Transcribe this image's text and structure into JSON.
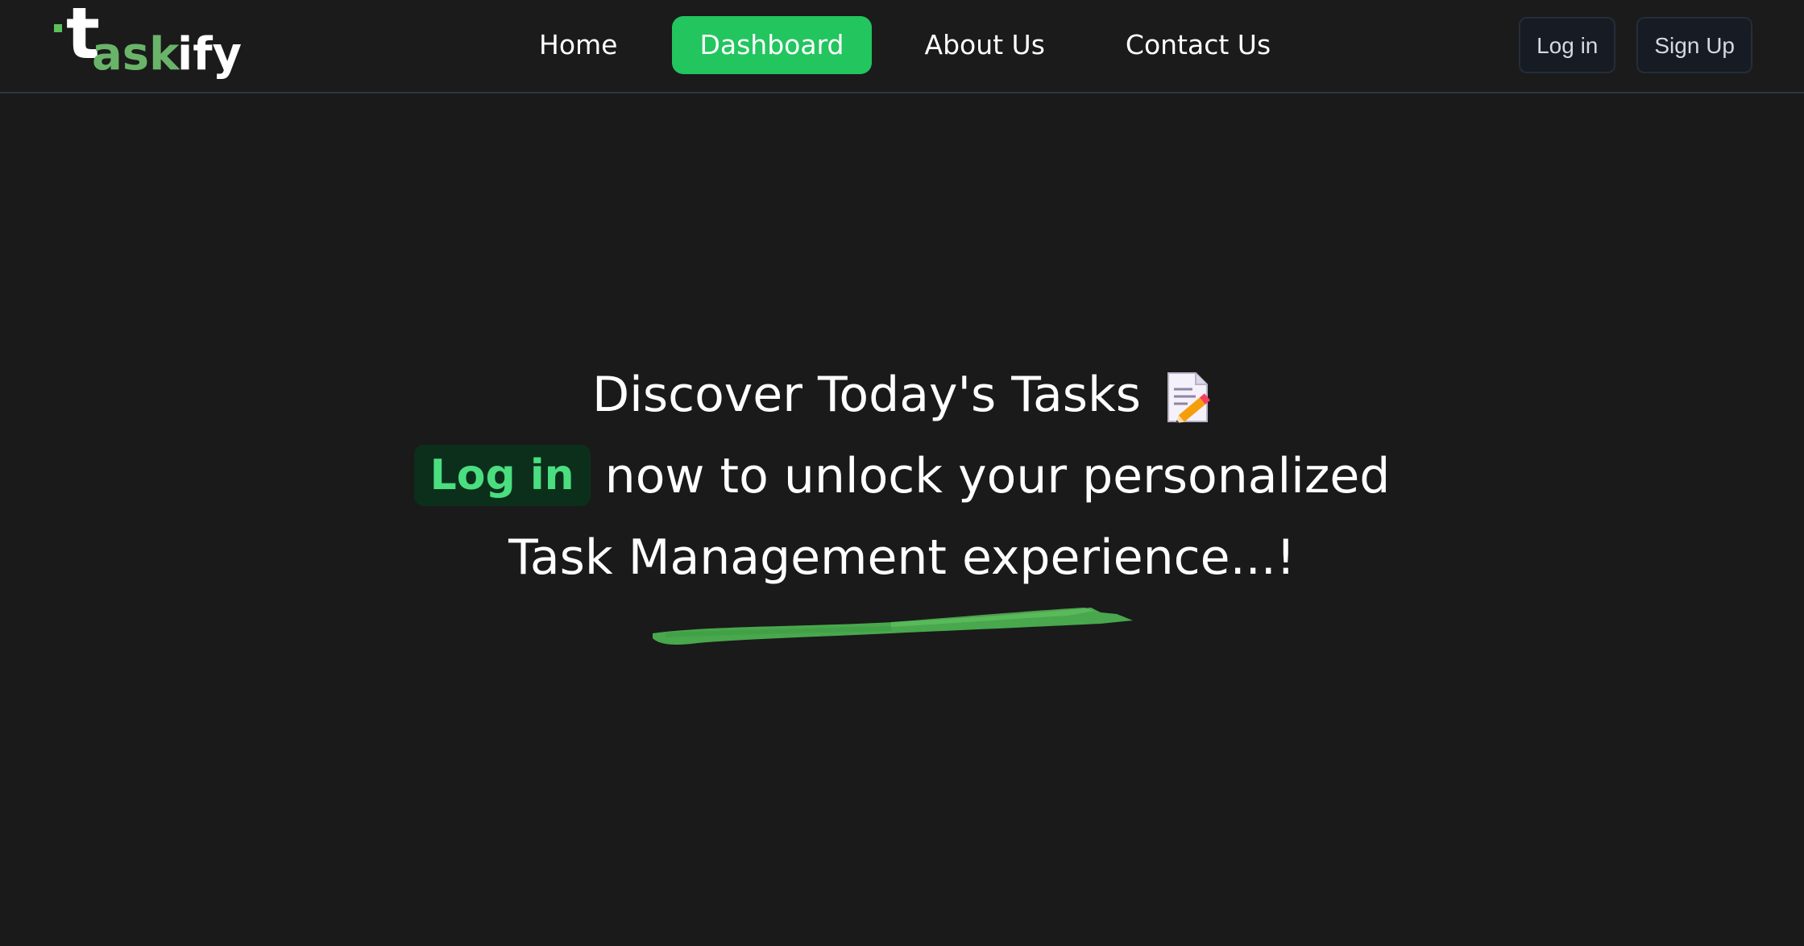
{
  "navbar": {
    "logo": {
      "letter_t": "t",
      "letters_ask": "ask",
      "letters_ify": "ify"
    },
    "links": {
      "home": "Home",
      "dashboard": "Dashboard",
      "about": "About Us",
      "contact": "Contact Us"
    },
    "auth": {
      "login": "Log in",
      "signup": "Sign Up"
    }
  },
  "hero": {
    "headline": "Discover Today's Tasks",
    "headline_icon": "memo-icon",
    "login_link": "Log in",
    "line2_rest": "now to unlock your personalized",
    "line3": "Task Management experience...!"
  },
  "colors": {
    "background": "#1a1a1a",
    "accent": "#22c55e",
    "login_highlight_bg": "#0c2f1b",
    "login_highlight_text": "#4ade80",
    "brush": "#4caf50"
  }
}
